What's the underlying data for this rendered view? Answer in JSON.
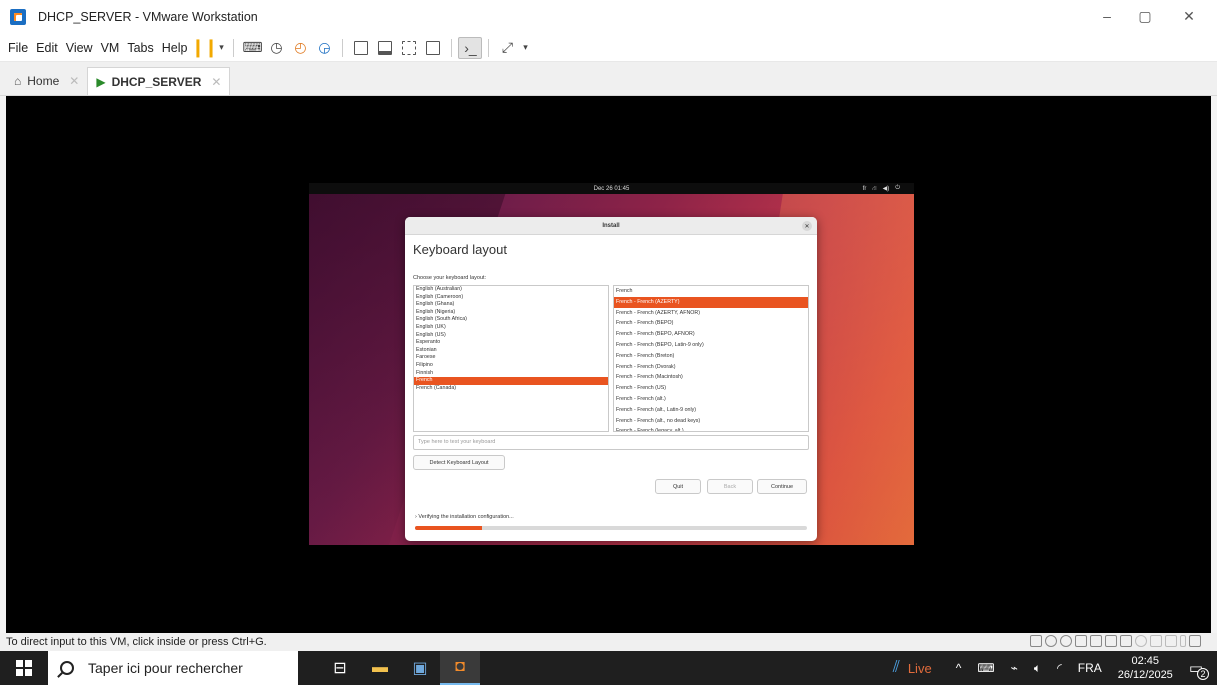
{
  "window": {
    "title": "DHCP_SERVER - VMware Workstation",
    "minimize": "–",
    "maximize": "▢",
    "close": "✕"
  },
  "menu": {
    "items": [
      "File",
      "Edit",
      "View",
      "VM",
      "Tabs",
      "Help"
    ]
  },
  "tabs": [
    {
      "label": "Home",
      "icon": "home-icon",
      "close": "✕"
    },
    {
      "label": "DHCP_SERVER",
      "icon": "vm-icon",
      "close": "✕"
    }
  ],
  "guest": {
    "topbar": {
      "datetime": "Dec 26 01:45",
      "keyboard_indicator": "fr",
      "icons": [
        "network-icon",
        "volume-icon",
        "power-icon"
      ]
    },
    "installer": {
      "window_title": "Install",
      "heading": "Keyboard layout",
      "prompt": "Choose your keyboard layout:",
      "languages": [
        "English (Australian)",
        "English (Cameroon)",
        "English (Ghana)",
        "English (Nigeria)",
        "English (South Africa)",
        "English (UK)",
        "English (US)",
        "Esperanto",
        "Estonian",
        "Faroese",
        "Filipino",
        "Finnish",
        "French",
        "French (Canada)"
      ],
      "selected_language": "French",
      "variants": [
        "French",
        "French - French (AZERTY)",
        "French - French (AZERTY, AFNOR)",
        "French - French (BEPO)",
        "French - French (BEPO, AFNOR)",
        "French - French (BEPO, Latin-9 only)",
        "French - French (Breton)",
        "French - French (Dvorak)",
        "French - French (Macintosh)",
        "French - French (US)",
        "French - French (alt.)",
        "French - French (alt., Latin-9 only)",
        "French - French (alt., no dead keys)",
        "French - French (legacy, alt.)"
      ],
      "selected_variant": "French - French (AZERTY)",
      "test_placeholder": "Type here to test your keyboard",
      "detect_button": "Detect Keyboard Layout",
      "quit_button": "Quit",
      "back_button": "Back",
      "continue_button": "Continue",
      "progress_text": "Verifying the installation configuration...",
      "progress_fraction": 0.17,
      "accent": "#e95420"
    }
  },
  "statusbar": {
    "text": "To direct input to this VM, click inside or press Ctrl+G."
  },
  "taskbar": {
    "search_placeholder": "Taper ici pour rechercher",
    "live_label": "Live",
    "language": "FRA",
    "time": "02:45",
    "date": "26/12/2025",
    "notification_count": "2"
  }
}
